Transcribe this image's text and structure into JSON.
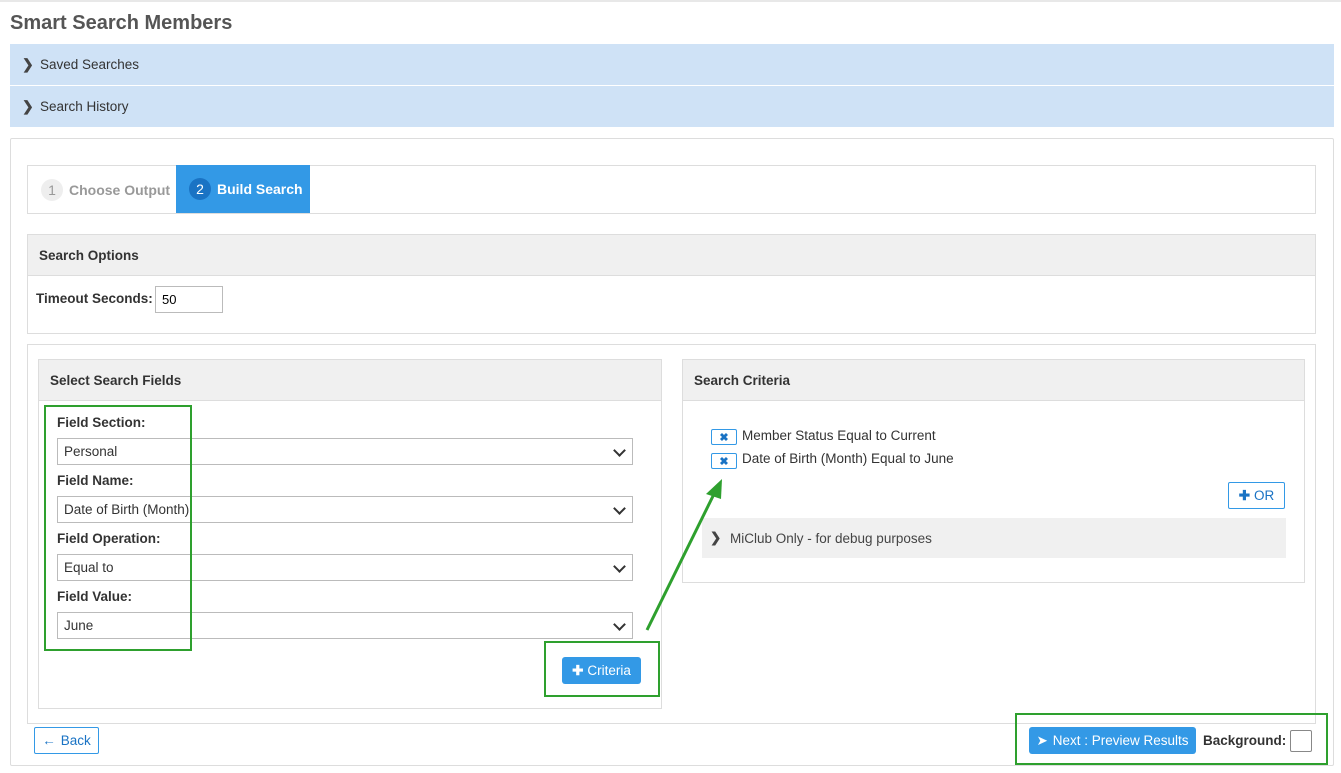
{
  "page": {
    "title": "Smart Search Members"
  },
  "accordions": {
    "saved_searches": "Saved Searches",
    "search_history": "Search History"
  },
  "wizard": {
    "steps": [
      {
        "num": "1",
        "label": "Choose Output"
      },
      {
        "num": "2",
        "label": "Build Search"
      }
    ]
  },
  "search_options": {
    "title": "Search Options",
    "timeout_label": "Timeout Seconds:",
    "timeout_value": "50"
  },
  "select_fields": {
    "title": "Select Search Fields",
    "section_label": "Field Section:",
    "section_value": "Personal",
    "name_label": "Field Name:",
    "name_value": "Date of Birth (Month)",
    "operation_label": "Field Operation:",
    "operation_value": "Equal to",
    "value_label": "Field Value:",
    "value_value": "June",
    "add_criteria_label": "Criteria"
  },
  "search_criteria": {
    "title": "Search Criteria",
    "items": [
      "Member Status Equal to Current",
      "Date of Birth (Month) Equal to June"
    ],
    "or_label": "OR",
    "debug_label": "MiClub Only - for debug purposes"
  },
  "footer": {
    "back_label": "Back",
    "next_label": "Next : Preview Results",
    "background_label": "Background:"
  },
  "colors": {
    "accent": "#3399e6",
    "accordion_bg": "#cfe2f6",
    "highlight": "#2ea02e"
  }
}
